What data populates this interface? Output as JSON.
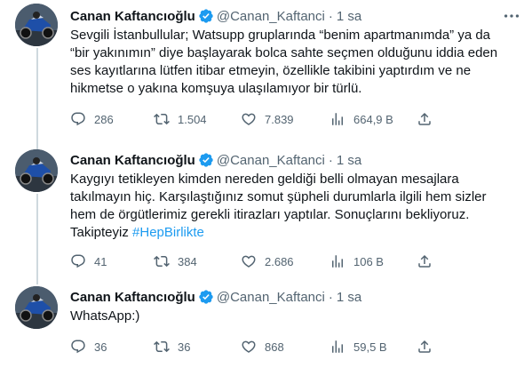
{
  "tweets": [
    {
      "display_name": "Canan Kaftancıoğlu",
      "handle": "@Canan_Kaftanci",
      "separator": "·",
      "time": "1 sa",
      "text_lines": [
        "Sevgili İstanbullular; Watsupp gruplarında “benim apartmanımda” ya da",
        "“bir yakınımın” diye başlayarak bolca sahte seçmen olduğunu iddia eden",
        "ses kayıtlarına lütfen itibar etmeyin, özellikle takibini yaptırdım ve ne",
        "hikmetse o yakına komşuya ulaşılamıyor bir türlü."
      ],
      "hashtag": "",
      "stats": {
        "replies": "286",
        "retweets": "1.504",
        "likes": "7.839",
        "views": "664,9 B"
      }
    },
    {
      "display_name": "Canan Kaftancıoğlu",
      "handle": "@Canan_Kaftanci",
      "separator": "·",
      "time": "1 sa",
      "text_lines": [
        "Kaygıyı tetikleyen kimden nereden geldiği belli olmayan mesajlara",
        "takılmayın hiç. Karşılaştığınız somut şüpheli durumlarla ilgili hem sizler",
        "hem de örgütlerimiz gerekli itirazları yaptılar. Sonuçlarını bekliyoruz.",
        "Takipteyiz "
      ],
      "hashtag": "#HepBirlikte",
      "stats": {
        "replies": "41",
        "retweets": "384",
        "likes": "2.686",
        "views": "106 B"
      }
    },
    {
      "display_name": "Canan Kaftancıoğlu",
      "handle": "@Canan_Kaftanci",
      "separator": "·",
      "time": "1 sa",
      "text_lines": [
        "WhatsApp:)"
      ],
      "hashtag": "",
      "stats": {
        "replies": "36",
        "retweets": "36",
        "likes": "868",
        "views": "59,5 B"
      }
    }
  ],
  "colors": {
    "text": "#0f1419",
    "secondary": "#536471",
    "link": "#1d9bf0",
    "verified": "#1d9bf0",
    "thread_line": "#cfd9de",
    "divider": "#eff3f4"
  }
}
